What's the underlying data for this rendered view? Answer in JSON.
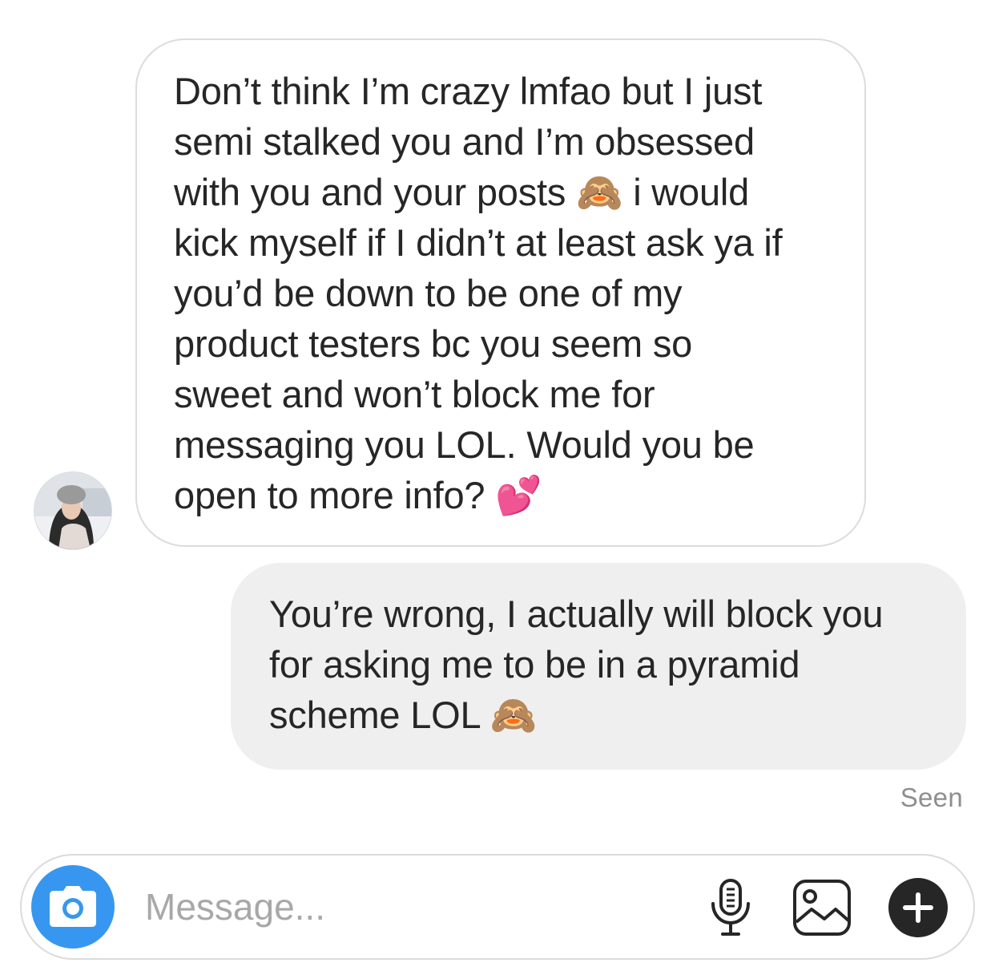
{
  "conversation": {
    "incoming": {
      "text": "Don’t think I’m crazy lmfao but I just\nsemi stalked you and I’m obsessed\nwith you and your posts 🙈 i would\nkick myself if I didn’t at least ask ya if\nyou’d be down to be one of my\nproduct testers bc you seem so\nsweet and won’t block me for\nmessaging you LOL. Would you be\nopen to more info? 💕"
    },
    "outgoing": {
      "text": "You’re wrong, I actually will block you\nfor asking me to be in a pyramid\nscheme LOL 🙈"
    },
    "status": "Seen"
  },
  "composer": {
    "placeholder": "Message...",
    "value": "",
    "icons": {
      "camera": "camera-icon",
      "mic": "microphone-icon",
      "gallery": "gallery-icon",
      "plus": "plus-icon"
    }
  },
  "colors": {
    "accent": "#3797f0",
    "text": "#262626",
    "muted": "#8e8e8e",
    "outgoing_bubble": "#efefef",
    "incoming_border": "#dcdcdc"
  }
}
